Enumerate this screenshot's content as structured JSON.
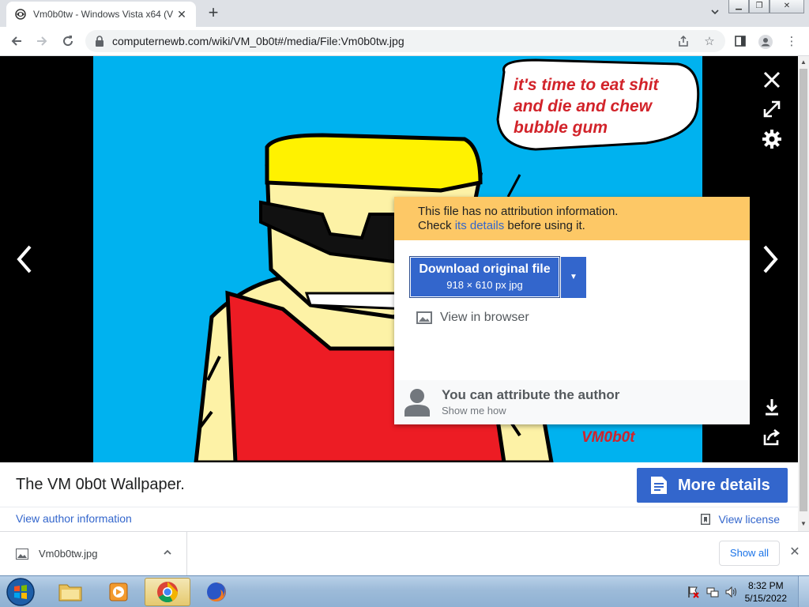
{
  "browser": {
    "tab_title": "Vm0b0tw - Windows Vista x64 (V",
    "url": "computernewb.com/wiki/VM_0b0t#/media/File:Vm0b0tw.jpg"
  },
  "artwork": {
    "speech_line1": "it's time to eat shit",
    "speech_line2": "and die and chew",
    "speech_line3": "bubble gum",
    "signature": "VM0b0t"
  },
  "popup": {
    "warning_line1": "This file has no attribution information.",
    "warning_check": "Check ",
    "warning_link": "its details",
    "warning_after": " before using it.",
    "download_label": "Download original file",
    "download_sub": "918 × 610 px jpg",
    "view_in_browser": "View in browser",
    "attrib_title": "You can attribute the author",
    "attrib_sub": "Show me how"
  },
  "caption": {
    "title": "The VM 0b0t Wallpaper.",
    "more_details": "More details",
    "view_author": "View author information",
    "view_license": "View license"
  },
  "download_shelf": {
    "file_name": "Vm0b0tw.jpg",
    "show_all": "Show all"
  },
  "taskbar": {
    "time": "8:32 PM",
    "date": "5/15/2022"
  },
  "colors": {
    "accent": "#3366cc",
    "warning_bg": "#fdc866",
    "sky": "#00b2ef"
  }
}
